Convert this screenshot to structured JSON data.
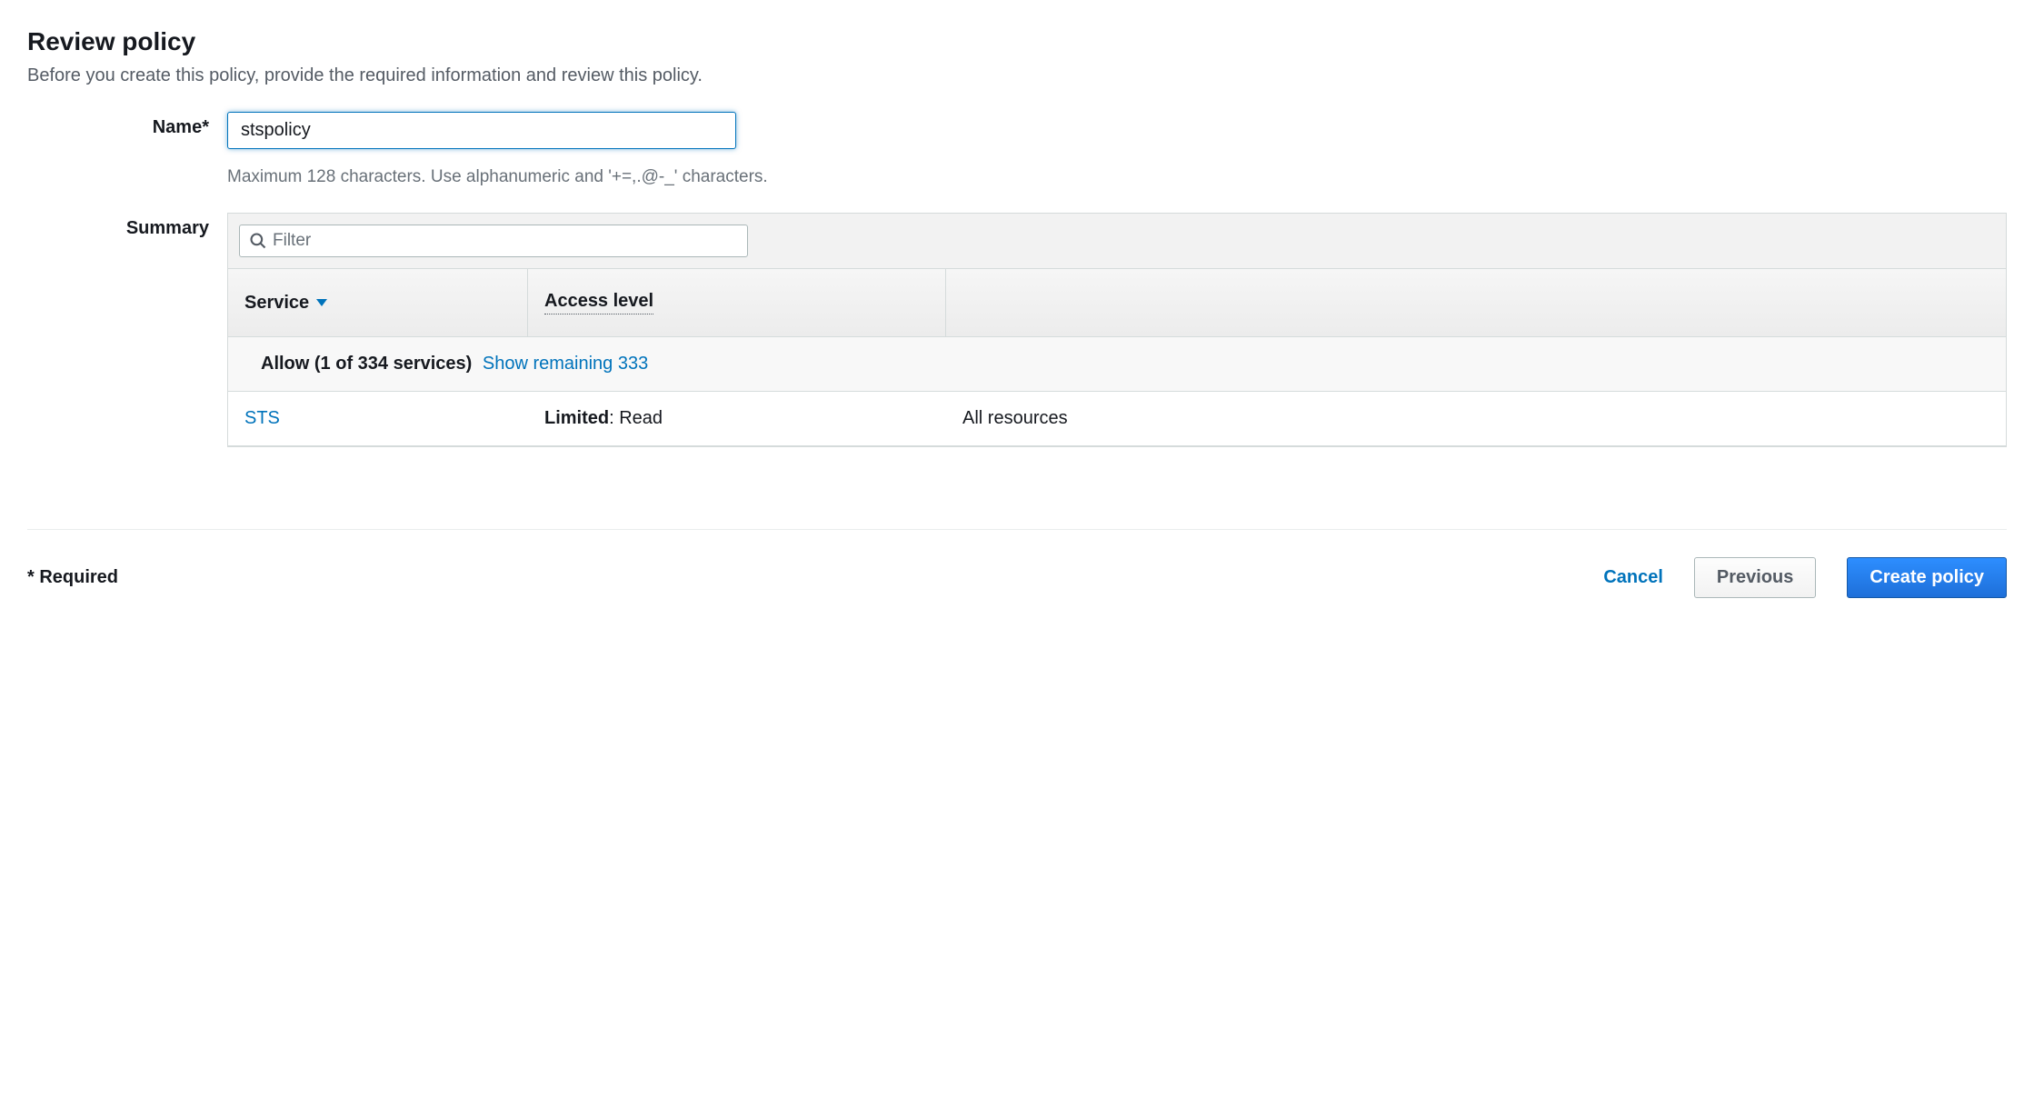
{
  "header": {
    "title": "Review policy",
    "subtitle": "Before you create this policy, provide the required information and review this policy."
  },
  "form": {
    "name_label": "Name*",
    "name_value": "stspolicy",
    "name_help": "Maximum 128 characters. Use alphanumeric and '+=,.@-_' characters."
  },
  "summary": {
    "label": "Summary",
    "filter_placeholder": "Filter",
    "columns": {
      "service": "Service",
      "access_level": "Access level"
    },
    "group": {
      "allow_text": "Allow (1 of 334 services)",
      "show_remaining_text": "Show remaining 333"
    },
    "rows": [
      {
        "service": "STS",
        "access_label": "Limited",
        "access_detail": ": Read",
        "resource": "All resources"
      }
    ]
  },
  "footer": {
    "required_note": "* Required",
    "cancel_label": "Cancel",
    "previous_label": "Previous",
    "create_label": "Create policy"
  }
}
